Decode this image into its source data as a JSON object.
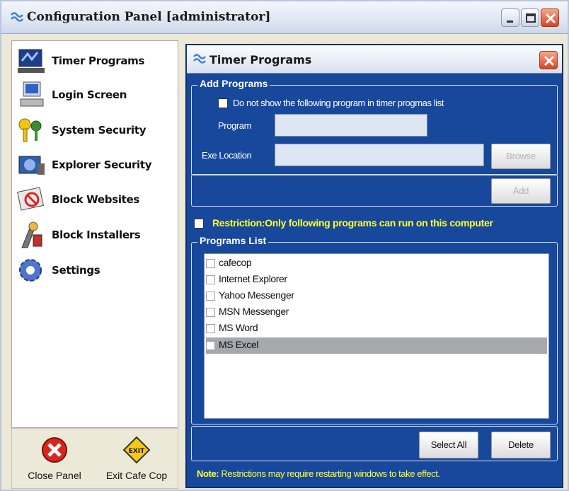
{
  "window": {
    "title": "Configuration Panel [administrator]"
  },
  "sidebar": {
    "items": [
      {
        "label": "Timer Programs",
        "icon": "computer-icon"
      },
      {
        "label": "Login Screen",
        "icon": "login-screen-icon"
      },
      {
        "label": "System Security",
        "icon": "keys-icon"
      },
      {
        "label": "Explorer Security",
        "icon": "explorer-security-icon"
      },
      {
        "label": "Block Websites",
        "icon": "block-websites-icon"
      },
      {
        "label": "Block Installers",
        "icon": "block-installers-icon"
      },
      {
        "label": "Settings",
        "icon": "gear-icon"
      }
    ],
    "bottom": {
      "close_label": "Close Panel",
      "exit_label": "Exit Cafe Cop"
    }
  },
  "panel": {
    "title": "Timer Programs",
    "add_programs": {
      "group_label": "Add Programs",
      "hide_checkbox_label": "Do not show the following program in timer progmas list",
      "program_label": "Program",
      "program_value": "",
      "exe_label": "Exe Location",
      "exe_value": "",
      "browse_label": "Browse",
      "add_label": "Add"
    },
    "restriction_label": "Restriction:Only following programs can run on this computer",
    "programs_list": {
      "group_label": "Programs List",
      "items": [
        {
          "name": "cafecop",
          "selected": false
        },
        {
          "name": "Internet Explorer",
          "selected": false
        },
        {
          "name": "Yahoo Messenger",
          "selected": false
        },
        {
          "name": "MSN Messenger",
          "selected": false
        },
        {
          "name": "MS Word",
          "selected": false
        },
        {
          "name": "MS Excel",
          "selected": true
        }
      ]
    },
    "select_all_label": "Select All",
    "delete_label": "Delete",
    "note_prefix": "Note:",
    "note_text": " Restrictions may require restarting windows to take effect."
  },
  "colors": {
    "panel_bg": "#17489b",
    "highlight_text": "#ffff33",
    "selected_row": "#a7a7ae"
  }
}
